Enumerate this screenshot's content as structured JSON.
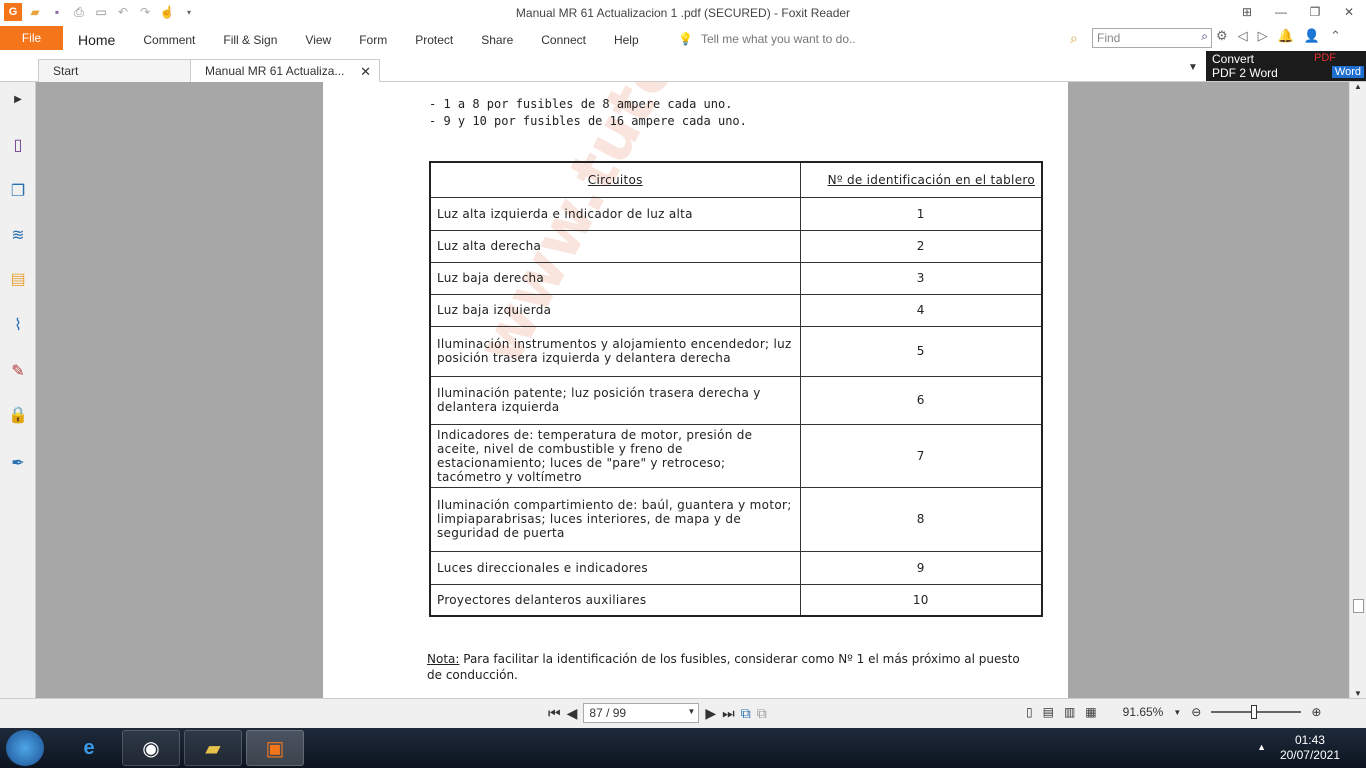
{
  "window": {
    "title": "Manual MR 61 Actualizacion 1 .pdf (SECURED) - Foxit Reader"
  },
  "ribbon": {
    "file_label": "File",
    "menu_items": [
      "Home",
      "Comment",
      "Fill & Sign",
      "View",
      "Form",
      "Protect",
      "Share",
      "Connect",
      "Help"
    ],
    "tell_me": "Tell me what you want to do..",
    "find_placeholder": "Find"
  },
  "tabs": {
    "start_label": "Start",
    "doc_label": "Manual MR 61 Actualiza..."
  },
  "convert": {
    "line1": "Convert",
    "line2": "PDF 2 Word",
    "pdf_label": "PDF",
    "word_label": "Word"
  },
  "document": {
    "intro_lines": [
      "- 1 a 8 por fusibles de 8 ampere cada uno.",
      "- 9 y 10 por fusibles de 16 ampere cada uno."
    ],
    "table_headers": [
      "Circuitos",
      "Nº de identificación en el tablero"
    ],
    "rows": [
      {
        "circuit": "Luz alta izquierda e indicador de luz alta",
        "num": "1"
      },
      {
        "circuit": "Luz alta derecha",
        "num": "2"
      },
      {
        "circuit": "Luz baja derecha",
        "num": "3"
      },
      {
        "circuit": "Luz baja izquierda",
        "num": "4"
      },
      {
        "circuit": "Iluminación instrumentos y alojamiento encendedor; luz posición trasera izquierda y delantera derecha",
        "num": "5"
      },
      {
        "circuit": "Iluminación patente; luz posición trasera derecha y delantera izquierda",
        "num": "6"
      },
      {
        "circuit": "Indicadores de: temperatura de motor, presión de aceite, nivel de combustible y freno de estacionamiento; luces de \"pare\" y retroceso; tacómetro y voltímetro",
        "num": "7"
      },
      {
        "circuit": "Iluminación compartimiento de: baúl, guantera y motor; limpiaparabrisas; luces interiores, de mapa y de seguridad de puerta",
        "num": "8"
      },
      {
        "circuit": "Luces direccionales e indicadores",
        "num": "9"
      },
      {
        "circuit": "Proyectores delanteros auxiliares",
        "num": "10"
      }
    ],
    "note_label": "Nota:",
    "note_text": "Para facilitar la identificación de los fusibles, considerar como Nº 1 el más próximo al puesto de conducción.",
    "watermark": "www.tutorino.com"
  },
  "status": {
    "page_indicator": "87 / 99",
    "zoom": "91.65%"
  },
  "taskbar": {
    "time": "01:43",
    "date": "20/07/2021"
  }
}
